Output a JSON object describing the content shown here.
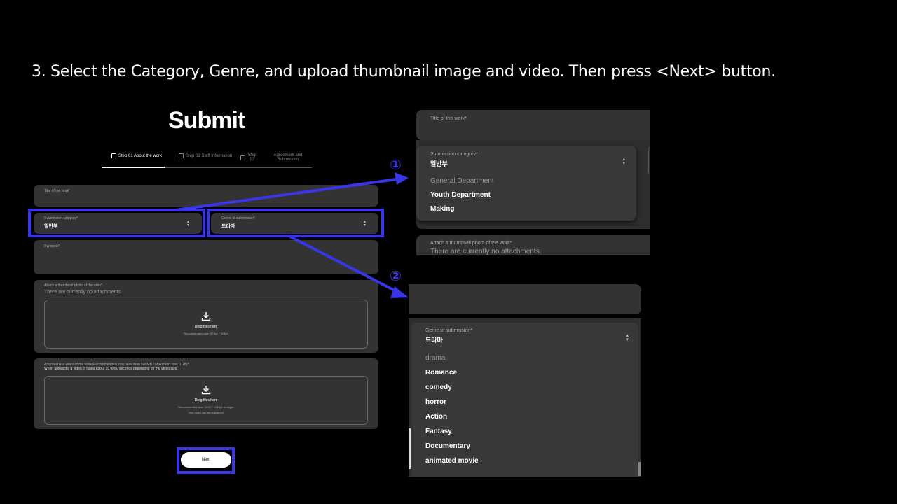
{
  "instruction": "3. Select the Category, Genre, and upload thumbnail image and video. Then press <Next> button.",
  "form": {
    "title": "Submit",
    "steps": [
      {
        "label": "Step 01 About the work"
      },
      {
        "label": "Step 02 Staff Information"
      },
      {
        "label": "Step 03"
      },
      {
        "label": "Agreement and Submission"
      }
    ],
    "title_field": {
      "label": "Title of the work*"
    },
    "category_field": {
      "label": "Submission category*",
      "value": "일반부"
    },
    "genre_field": {
      "label": "Genre of submission*",
      "value": "드라마"
    },
    "synopsis_field": {
      "label": "Synopsis*"
    },
    "thumbnail": {
      "label": "Attach a thumbnail photo of the work*",
      "empty_text": "There are currently no attachments.",
      "drag_text": "Drag files here",
      "recommended": "Recommended size: 575px * 323px"
    },
    "video": {
      "label": "Attached is a video of the work(Recommended size: less than 500MB / Maximum size: 1GB)*",
      "note": "When uploading a video, it takes about 10 to 60 seconds depending on the video size.",
      "drag_text": "Drag files here",
      "recommended": "Recommended size: 1920 * 1080px or larger",
      "limit": "One video can be registered"
    },
    "next_label": "Next"
  },
  "callout_1": {
    "number": "①",
    "title_label": "Title of the work*",
    "category_label": "Submission category*",
    "category_value": "일반부",
    "options": [
      "General Department",
      "Youth Department",
      "Making"
    ],
    "thumb_label": "Attach a thumbnail photo of the work*",
    "thumb_empty": "There are currently no attachments."
  },
  "callout_2": {
    "number": "②",
    "genre_label": "Genre of submission*",
    "genre_value": "드라마",
    "options": [
      "drama",
      "Romance",
      "comedy",
      "horror",
      "Action",
      "Fantasy",
      "Documentary",
      "animated movie"
    ]
  },
  "colors": {
    "highlight": "#3a35e6",
    "card": "#333333",
    "background": "#000000"
  }
}
